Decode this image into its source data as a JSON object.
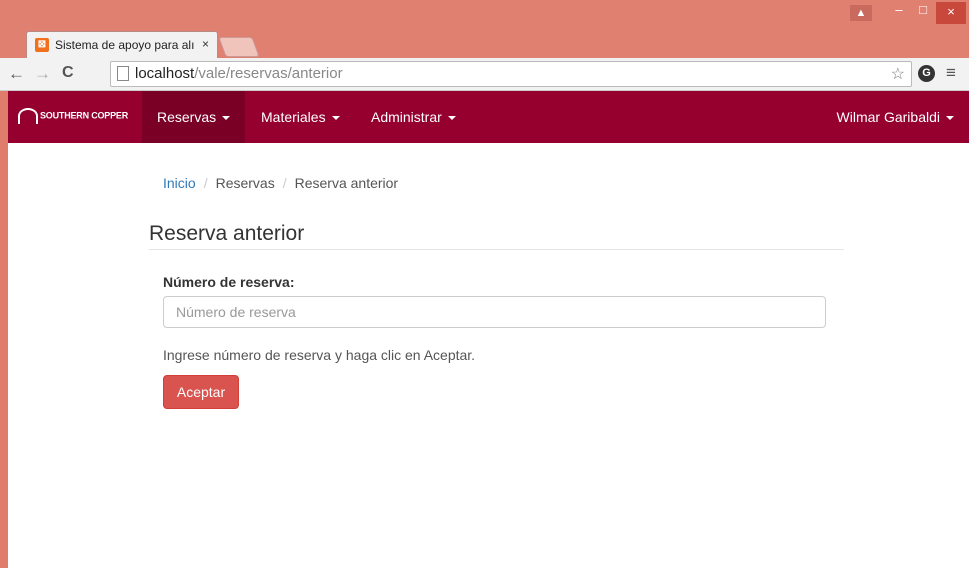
{
  "browser": {
    "tab_title": "Sistema de apoyo para alı",
    "tab_close": "×",
    "url_host": "localhost",
    "url_path": "/vale/reservas/anterior",
    "window_controls": {
      "user": "▲",
      "minimize": "–",
      "maximize": "□",
      "close": "×"
    },
    "nav": {
      "back": "←",
      "forward": "→",
      "reload": "C"
    },
    "star": "☆",
    "extension": "G",
    "menu": "≡"
  },
  "navbar": {
    "brand": "SOUTHERN COPPER",
    "items": [
      {
        "label": "Reservas"
      },
      {
        "label": "Materiales"
      },
      {
        "label": "Administrar"
      }
    ],
    "user": "Wilmar Garibaldi"
  },
  "breadcrumb": {
    "home": "Inicio",
    "section": "Reservas",
    "current": "Reserva anterior",
    "separator": "/"
  },
  "form": {
    "heading": "Reserva anterior",
    "label": "Número de reserva:",
    "placeholder": "Número de reserva",
    "value": "",
    "help": "Ingrese número de reserva y haga clic en Aceptar.",
    "submit": "Aceptar"
  },
  "colors": {
    "navbar": "#95002e",
    "button": "#d9534f",
    "link": "#337ab7"
  }
}
